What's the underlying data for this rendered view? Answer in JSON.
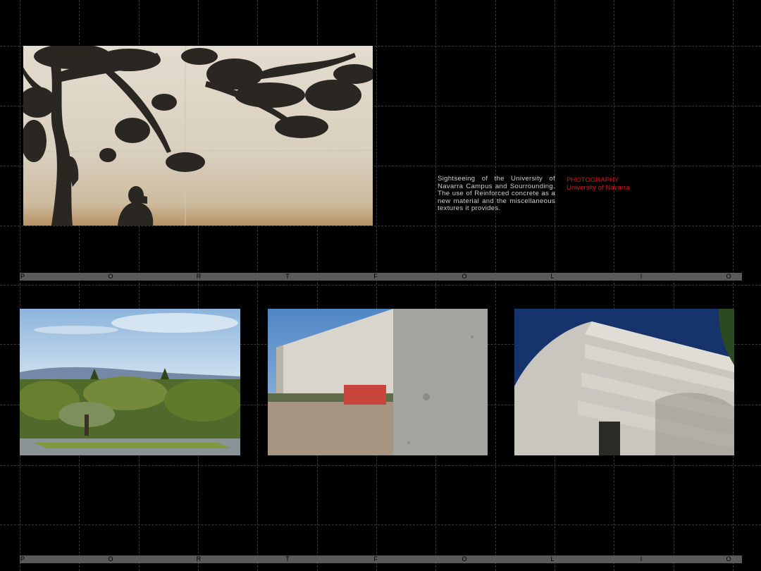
{
  "description": "Sightseeing of the University of Navarra Campus and Sourrounding. The use of Reinforced concrete as a new material and the miscellaneous textures it provides.",
  "tag": {
    "category": "PHOTOGRAPHY",
    "location": "University of Navarra"
  },
  "band_letters": [
    "P",
    "O",
    "R",
    "T",
    "F",
    "O",
    "L",
    "I",
    "O"
  ],
  "colors": {
    "background": "#000000",
    "band": "#5a5a5a",
    "accent": "#d4161c",
    "text": "#cfcfcf"
  }
}
